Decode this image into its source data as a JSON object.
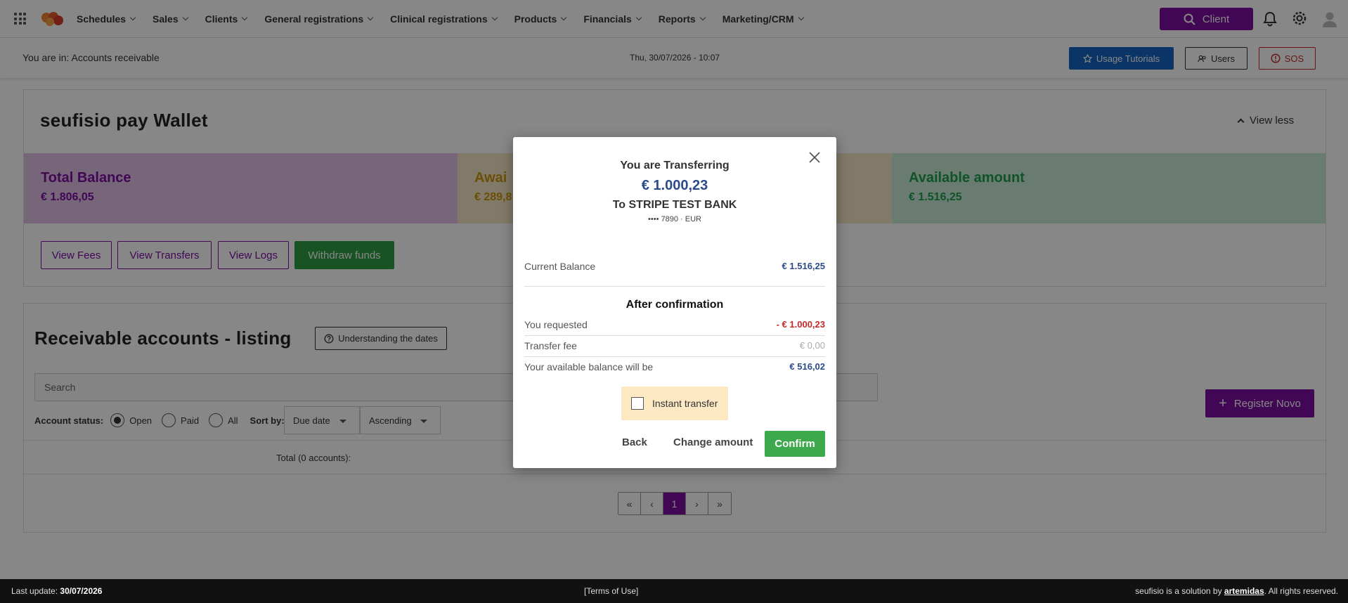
{
  "nav": {
    "items": [
      "Schedules",
      "Sales",
      "Clients",
      "General registrations",
      "Clinical registrations",
      "Products",
      "Financials",
      "Reports",
      "Marketing/CRM"
    ],
    "client_button": "Client"
  },
  "subbar": {
    "location": "You are in: Accounts receivable",
    "datetime": "Thu, 30/07/2026 - 10:07",
    "tutorials": "Usage Tutorials",
    "users": "Users",
    "sos": "SOS"
  },
  "wallet": {
    "title": "seufisio pay Wallet",
    "view_less": "View less",
    "balances": [
      {
        "label": "Total Balance",
        "value": "€ 1.806,05",
        "color": "#7b0fa0"
      },
      {
        "label": "Awai",
        "value": "€ 289,8",
        "color": "#c9960c"
      },
      {
        "label": "Available amount",
        "value": "€ 1.516,25",
        "color": "#1e9e4a"
      }
    ],
    "buttons": {
      "fees": "View Fees",
      "transfers": "View Transfers",
      "logs": "View Logs",
      "withdraw": "Withdraw funds"
    }
  },
  "listing": {
    "title": "Receivable accounts - listing",
    "dates_button": "Understanding the dates",
    "search_placeholder": "Search",
    "status_label": "Account status:",
    "status_options": [
      "Open",
      "Paid",
      "All"
    ],
    "selected_status": "Open",
    "sort_label": "Sort by:",
    "sort_field": "Due date",
    "sort_order": "Ascending",
    "register_button": "Register Novo",
    "total": "Total (0 accounts):",
    "current_page": "1"
  },
  "modal": {
    "heading": "You are Transferring",
    "amount": "€ 1.000,23",
    "bank": "To STRIPE TEST BANK",
    "account": "•••• 7890 · EUR",
    "current_balance_label": "Current Balance",
    "current_balance_value": "€ 1.516,25",
    "after_heading": "After confirmation",
    "requested_label": "You requested",
    "requested_value": "- € 1.000,23",
    "fee_label": "Transfer fee",
    "fee_value": "€ 0,00",
    "available_label": "Your available balance will be",
    "available_value": "€ 516,02",
    "instant_label": "Instant transfer",
    "instant_checked": false,
    "back": "Back",
    "change": "Change amount",
    "confirm": "Confirm"
  },
  "footer": {
    "last_update_label": "Last update:",
    "last_update_value": "30/07/2026",
    "terms": "[Terms of Use]",
    "credit_prefix": "seufisio is a solution by",
    "credit_brand": "artemidas",
    "credit_suffix": ". All rights reserved."
  }
}
